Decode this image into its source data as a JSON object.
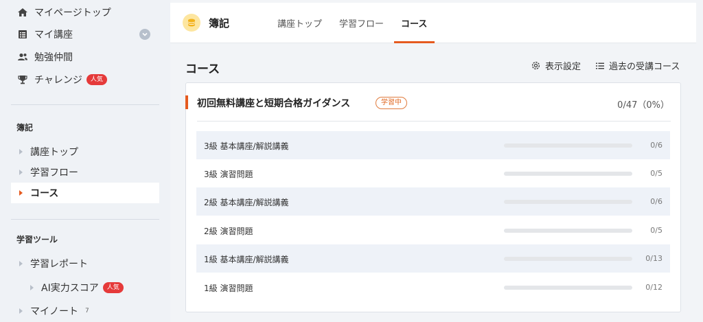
{
  "sidebar": {
    "top_items": [
      {
        "label": "マイページトップ",
        "icon": "home-icon"
      },
      {
        "label": "マイ講座",
        "icon": "list-icon"
      },
      {
        "label": "勉強仲間",
        "icon": "people-icon"
      },
      {
        "label": "チャレンジ",
        "icon": "trophy-icon",
        "badge": "人気"
      }
    ],
    "sections": [
      {
        "title": "簿記",
        "items": [
          {
            "label": "講座トップ",
            "active": false
          },
          {
            "label": "学習フロー",
            "active": false
          },
          {
            "label": "コース",
            "active": true
          }
        ]
      },
      {
        "title": "学習ツール",
        "items": [
          {
            "label": "学習レポート"
          },
          {
            "label": "AI実力スコア",
            "badge": "人気"
          },
          {
            "label": "マイノート",
            "count": "7"
          }
        ]
      }
    ]
  },
  "header": {
    "subject": "簿記",
    "tabs": [
      "講座トップ",
      "学習フロー",
      "コース"
    ],
    "active_tab": "コース"
  },
  "main": {
    "title": "コース",
    "tools": {
      "display_settings": "表示設定",
      "past_courses": "過去の受講コース"
    },
    "course": {
      "title": "初回無料講座と短期合格ガイダンス",
      "status": "学習中",
      "progress": "0/47（0%）",
      "rows": [
        {
          "label": "3級 基本講座/解説講義",
          "count": "0/6",
          "progress": 0
        },
        {
          "label": "3級 演習問題",
          "count": "0/5",
          "progress": 0
        },
        {
          "label": "2級 基本講座/解説講義",
          "count": "0/6",
          "progress": 0
        },
        {
          "label": "2級 演習問題",
          "count": "0/5",
          "progress": 0
        },
        {
          "label": "1級 基本講座/解説講義",
          "count": "0/13",
          "progress": 0
        },
        {
          "label": "1級 演習問題",
          "count": "0/12",
          "progress": 0
        }
      ]
    }
  },
  "colors": {
    "accent": "#e55a1f",
    "badge_red": "#e53a3a",
    "row_shade": "#eef2f8"
  }
}
